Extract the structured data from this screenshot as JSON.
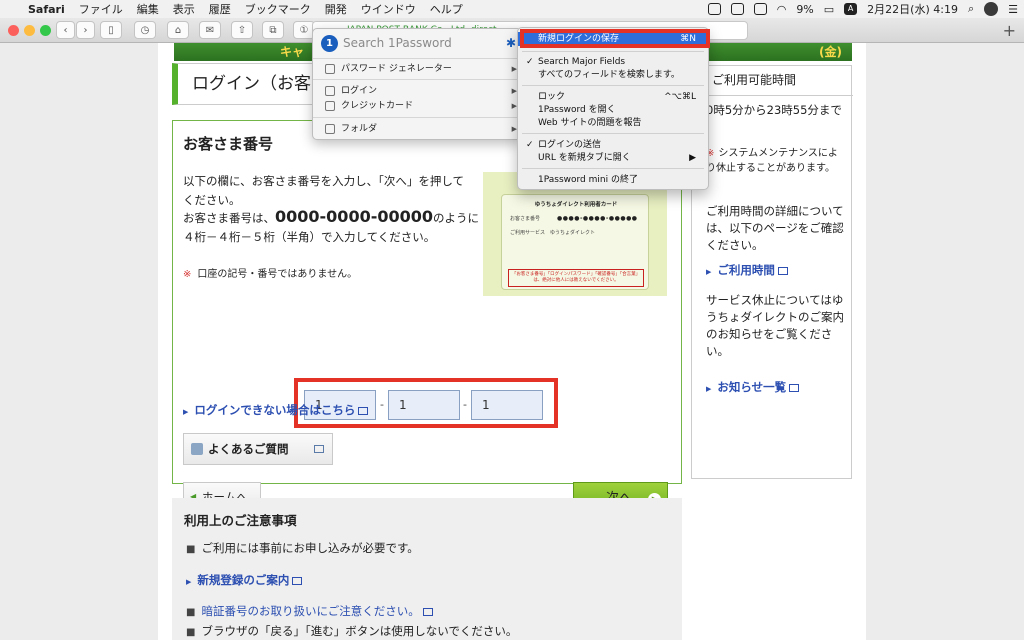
{
  "menubar": {
    "app": "Safari",
    "items": [
      "ファイル",
      "編集",
      "表示",
      "履歴",
      "ブックマーク",
      "開発",
      "ウインドウ",
      "ヘルプ"
    ],
    "battery": "9%",
    "input_source": "A",
    "clock": "2月22日(水) 4:19"
  },
  "toolbar": {
    "address_snippet": "JAPAN POST BANK Co., Ltd. direct.",
    "new_tab": "+"
  },
  "page": {
    "banner_left": "キャ",
    "banner_right": "(金)",
    "login_title": "ログイン（お客さ",
    "card": {
      "heading": "お客さま番号",
      "instruction": "以下の欄に、お客さま番号を入力し、「次へ」を押してください。",
      "format_pre": "お客さま番号は、",
      "format_num": "0000-0000-00000",
      "format_post": "のように４桁－４桁－５桁（半角）で入力してください。",
      "note": "口座の記号・番号ではありません。",
      "note_mark": "※",
      "inputs": [
        "1",
        "1",
        "1"
      ],
      "dash": "-",
      "help_link": "ログインできない場合はこちら",
      "faq": "よくあるご質問",
      "home": "ホームへ",
      "next": "次へ",
      "image": {
        "title": "ゆうちょダイレクト利用者カード",
        "line1": "お客さま番号",
        "line1_value": "●●●●-●●●●-●●●●●",
        "line2": "ご利用サービス　ゆうちょダイレクト",
        "warning": "「お客さま番号」「ログインパスワード」「確認番号」「合言葉」は、絶対に他人には教えないでください。"
      }
    },
    "notes": {
      "heading": "利用上のご注意事項",
      "item1": "ご利用には事前にお申し込みが必要です。",
      "link1": "新規登録のご案内",
      "link2": "暗証番号のお取り扱いにご注意ください。",
      "item2": "ブラウザの「戻る」「進む」ボタンは使用しないでください。"
    },
    "side": {
      "heading": "ご利用可能時間",
      "hours": "0時5分から23時55分まで",
      "maintenance_mark": "※",
      "maintenance": "システムメンテナンスにより休止することがあります。",
      "detail": "ご利用時間の詳細については、以下のページをご確認ください。",
      "link_hours": "ご利用時間",
      "suspension": "サービス休止についてはゆうちょダイレクトのご案内のお知らせをご覧ください。",
      "link_news": "お知らせ一覧"
    }
  },
  "onepassword": {
    "search_placeholder": "Search 1Password",
    "password_generator": "パスワード ジェネレーター",
    "login": "ログイン",
    "credit_card": "クレジットカード",
    "folder": "フォルダ"
  },
  "context_menu": {
    "save_login": "新規ログインの保存",
    "save_login_shortcut": "⌘N",
    "search_major": "Search Major Fields",
    "search_all": "すべてのフィールドを検索します。",
    "lock": "ロック",
    "lock_shortcut": "^⌥⌘L",
    "open_1password": "1Password を開く",
    "report_issue": "Web サイトの問題を報告",
    "submit_login": "ログインの送信",
    "open_url_tab": "URL を新規タブに開く",
    "quit_mini": "1Password mini の終了"
  },
  "colors": {
    "accent_green": "#55b02b",
    "highlight_blue": "#2e6edb",
    "annotation_red": "#e53226",
    "link_blue": "#2c4fb1"
  }
}
